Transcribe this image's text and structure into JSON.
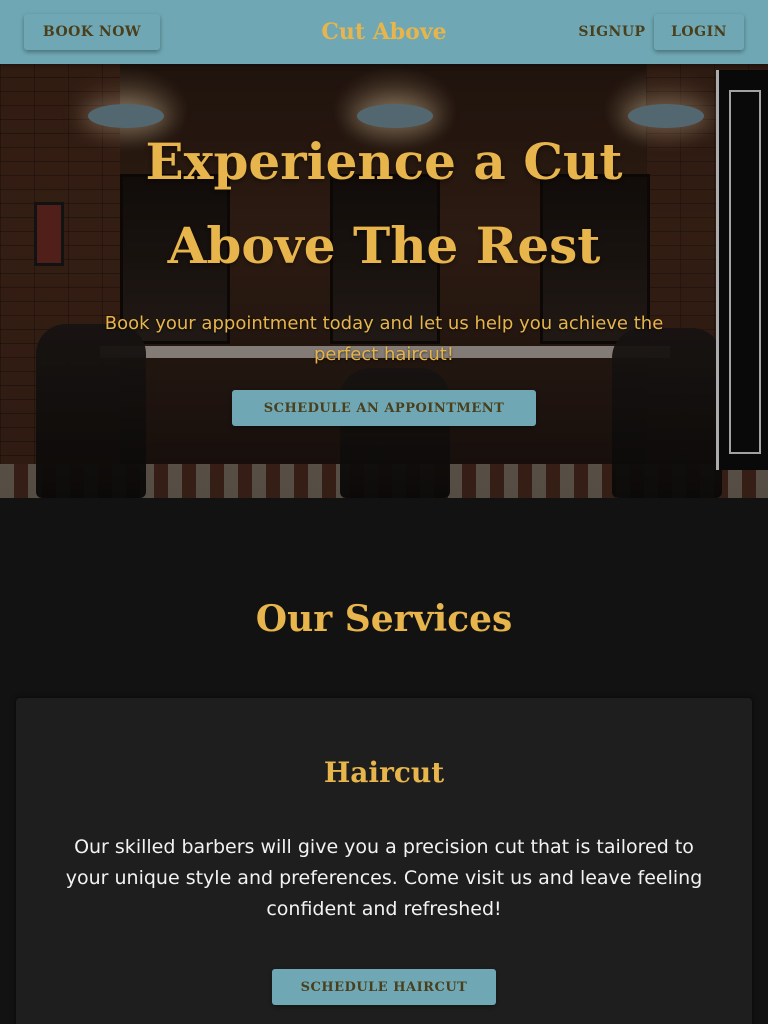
{
  "header": {
    "brand": "Cut Above",
    "book_now": "BOOK NOW",
    "signup": "SIGNUP",
    "login": "LOGIN"
  },
  "hero": {
    "title_line1": "Experience a Cut",
    "title_line2": "Above The Rest",
    "subtitle": "Book your appointment today and let us help you achieve the perfect haircut!",
    "cta": "SCHEDULE AN APPOINTMENT"
  },
  "services": {
    "heading": "Our Services",
    "items": [
      {
        "title": "Haircut",
        "description": "Our skilled barbers will give you a precision cut that is tailored to your unique style and preferences. Come visit us and leave feeling confident and refreshed!",
        "cta": "SCHEDULE HAIRCUT"
      }
    ]
  },
  "colors": {
    "header_bg": "#6fa8b4",
    "accent_gold": "#e7b54b",
    "page_bg": "#121212",
    "card_bg": "#1e1e1e",
    "button_text": "#4a3f1c"
  }
}
